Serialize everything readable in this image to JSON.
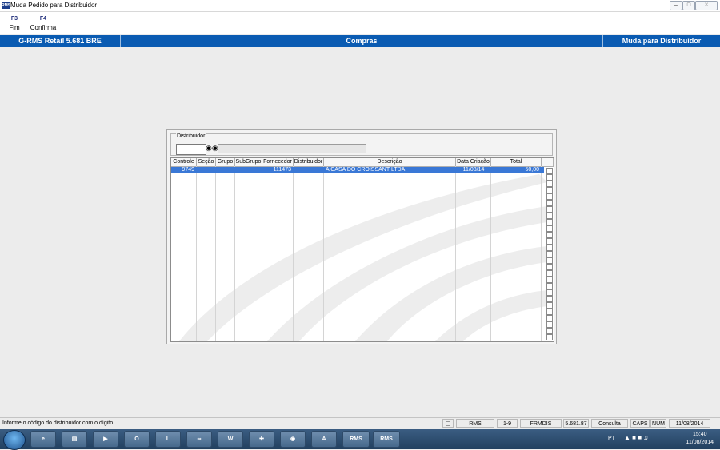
{
  "window": {
    "title": "Muda Pedido para Distribuidor",
    "app_icon": "RMS"
  },
  "toolbar": {
    "keys": [
      {
        "key": "F3",
        "label": "Fim"
      },
      {
        "key": "F4",
        "label": "Confirma"
      }
    ]
  },
  "header": {
    "left": "G-RMS Retail 5.681 BRE",
    "center": "Compras",
    "right": "Muda para Distribuidor"
  },
  "distribuidor": {
    "label": "Distribuidor",
    "code_value": "",
    "description_value": ""
  },
  "grid": {
    "columns": [
      "Controle",
      "Seção",
      "Grupo",
      "SubGrupo",
      "Fornecedor",
      "Distribuidor",
      "Descrição",
      "Data Criação",
      "Total",
      ""
    ],
    "rows": [
      {
        "controle": "9749",
        "secao": "",
        "grupo": "",
        "subgrupo": "",
        "fornecedor": "111473",
        "distribuidor": "",
        "descricao": "A CASA DO CROISSANT LTDA",
        "data_criacao": "11/08/14",
        "total": "50,00",
        "checked": false
      }
    ],
    "checkbox_count": 27
  },
  "status": {
    "message": "Informe o código do distribuidor com o dígito",
    "fields": [
      "RMS",
      "1-9",
      "FRMDIS",
      "5.681.87",
      "Consulta",
      "CAPS",
      "NUM",
      "11/08/2014"
    ]
  },
  "taskbar": {
    "apps": [
      "ie-icon",
      "explorer-icon",
      "media-player-icon",
      "outlook-icon",
      "lync-icon",
      "messenger-icon",
      "word-icon",
      "store-icon",
      "compass-icon",
      "acrobat-icon"
    ],
    "rms_buttons": [
      "RMS",
      "RMS"
    ],
    "lang": "PT",
    "time": "15:40",
    "date": "11/08/2014"
  },
  "colors": {
    "header_blue": "#0a5bb2",
    "selection_blue": "#3a78d6",
    "taskbar": "#2c4b6e"
  }
}
